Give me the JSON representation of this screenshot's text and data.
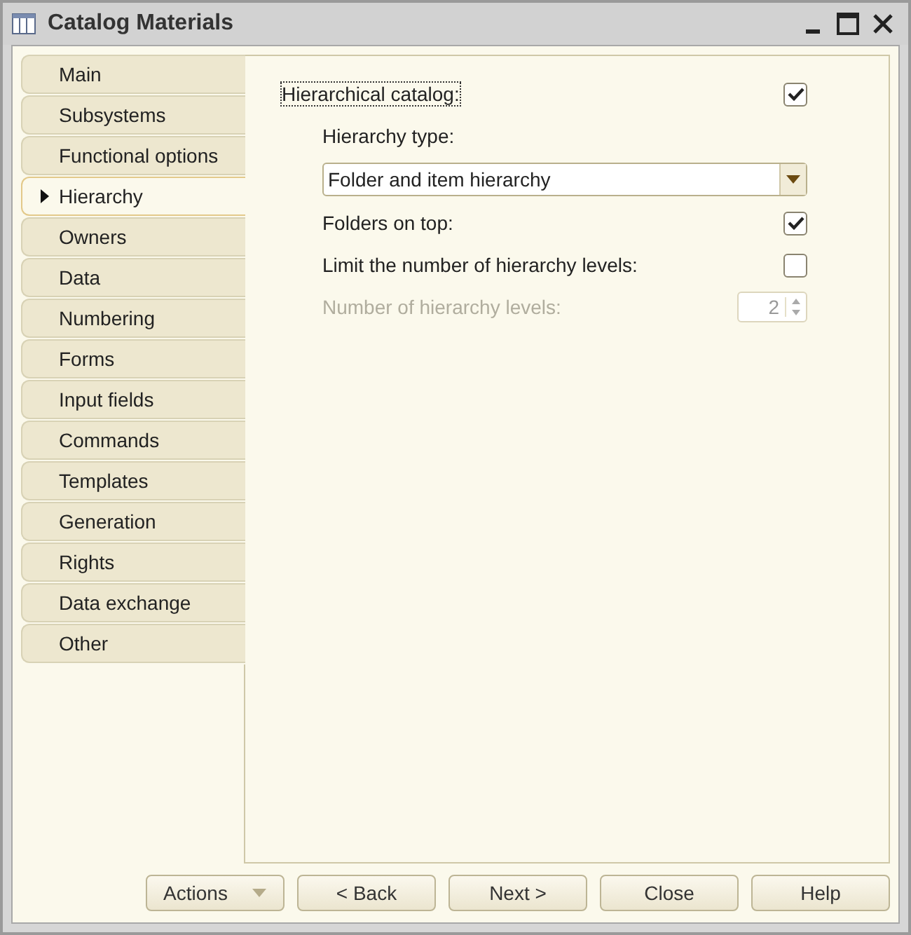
{
  "window": {
    "title": "Catalog Materials"
  },
  "tabs": [
    {
      "label": "Main",
      "selected": false
    },
    {
      "label": "Subsystems",
      "selected": false
    },
    {
      "label": "Functional options",
      "selected": false
    },
    {
      "label": "Hierarchy",
      "selected": true
    },
    {
      "label": "Owners",
      "selected": false
    },
    {
      "label": "Data",
      "selected": false
    },
    {
      "label": "Numbering",
      "selected": false
    },
    {
      "label": "Forms",
      "selected": false
    },
    {
      "label": "Input fields",
      "selected": false
    },
    {
      "label": "Commands",
      "selected": false
    },
    {
      "label": "Templates",
      "selected": false
    },
    {
      "label": "Generation",
      "selected": false
    },
    {
      "label": "Rights",
      "selected": false
    },
    {
      "label": "Data exchange",
      "selected": false
    },
    {
      "label": "Other",
      "selected": false
    }
  ],
  "form": {
    "hierarchical_catalog": {
      "label": "Hierarchical catalog:",
      "checked": true
    },
    "hierarchy_type": {
      "label": "Hierarchy type:",
      "value": "Folder and item hierarchy"
    },
    "folders_on_top": {
      "label": "Folders on top:",
      "checked": true
    },
    "limit_levels": {
      "label": "Limit the number of hierarchy levels:",
      "checked": false
    },
    "number_of_levels": {
      "label": "Number of hierarchy levels:",
      "value": "2",
      "disabled": true
    }
  },
  "buttons": [
    {
      "label": "Actions",
      "kind": "dropdown"
    },
    {
      "label": "< Back",
      "kind": "plain"
    },
    {
      "label": "Next >",
      "kind": "plain"
    },
    {
      "label": "Close",
      "kind": "plain"
    },
    {
      "label": "Help",
      "kind": "plain"
    }
  ]
}
